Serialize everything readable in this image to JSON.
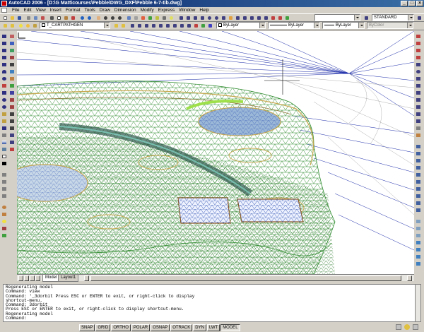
{
  "window": {
    "title": "AutoCAD 2006 - [D:\\G Matt\\courses\\Pebble\\DWG_DXF\\Pebble 6-7-tib.dwg]"
  },
  "menu": [
    "File",
    "Edit",
    "View",
    "Insert",
    "Format",
    "Tools",
    "Draw",
    "Dimension",
    "Modify",
    "Express",
    "Window",
    "Help"
  ],
  "toolbar": {
    "textstyle": "STANDARD"
  },
  "layers": {
    "current": "T_CARTPATHGEN",
    "color": "ByLayer",
    "linetype": "ByLayer",
    "lineweight": "ByLayer",
    "plotstyle": "ByColor"
  },
  "tabs": [
    "Model",
    "Layout1"
  ],
  "command_history": [
    "Regenerating model",
    "Command: view",
    "Command: '_3dorbit Press ESC or ENTER to exit, or right-click to display",
    "shortcut-menu.",
    "Command: 3dorbit",
    "Press ESC or ENTER to exit, or right-click to display shortcut-menu.",
    "Regenerating model",
    "Command:"
  ],
  "status_toggles": [
    "SNAP",
    "GRID",
    "ORTHO",
    "POLAR",
    "OSNAP",
    "OTRACK",
    "DYN",
    "LWT",
    "MODEL"
  ],
  "colors": {
    "titlebar": "#0a246a",
    "contour_green": "#2e8b2e",
    "grid_blue": "#1a2aa8",
    "water": "#9bb8d8",
    "path_gold": "#c8a850"
  }
}
